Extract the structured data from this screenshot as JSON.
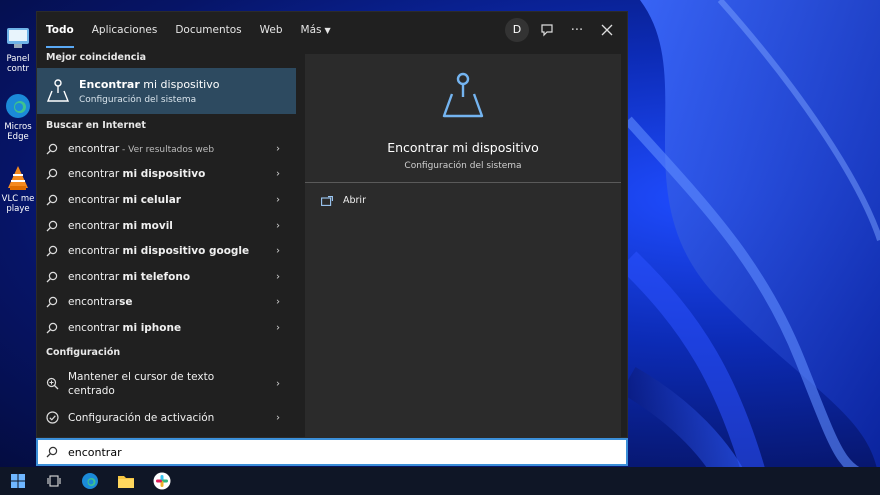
{
  "desktop": {
    "icons": [
      {
        "label": "Panel contr",
        "icon": "control-panel-icon"
      },
      {
        "label": "Micros Edge",
        "icon": "edge-icon"
      },
      {
        "label": "VLC me playe",
        "icon": "vlc-icon"
      }
    ]
  },
  "tabs": [
    {
      "label": "Todo",
      "active": true
    },
    {
      "label": "Aplicaciones"
    },
    {
      "label": "Documentos"
    },
    {
      "label": "Web"
    },
    {
      "label": "Más"
    }
  ],
  "top_actions": {
    "avatar": "D",
    "icons": [
      "feedback-icon",
      "more-icon",
      "close-icon"
    ]
  },
  "best_match": {
    "header": "Mejor coincidencia",
    "title_bold": "Encontrar",
    "title_rest": " mi dispositivo",
    "subtitle": "Configuración del sistema"
  },
  "internet": {
    "header": "Buscar en Internet",
    "items": [
      {
        "base": "encontrar",
        "bold": "",
        "suffix": " - Ver resultados web"
      },
      {
        "base": "encontrar ",
        "bold": "mi dispositivo",
        "suffix": ""
      },
      {
        "base": "encontrar ",
        "bold": "mi celular",
        "suffix": ""
      },
      {
        "base": "encontrar ",
        "bold": "mi movil",
        "suffix": ""
      },
      {
        "base": "encontrar ",
        "bold": "mi dispositivo google",
        "suffix": ""
      },
      {
        "base": "encontrar ",
        "bold": "mi telefono",
        "suffix": ""
      },
      {
        "base": "encontrar",
        "bold": "se",
        "suffix": ""
      },
      {
        "base": "encontrar ",
        "bold": "mi iphone",
        "suffix": ""
      }
    ]
  },
  "config": {
    "header": "Configuración",
    "items": [
      {
        "line1": "Mantener el cursor de texto",
        "line2": "centrado"
      },
      {
        "line1": "Configuración de activación",
        "line2": ""
      }
    ]
  },
  "preview": {
    "title": "Encontrar mi dispositivo",
    "subtitle": "Configuración del sistema",
    "action": "Abrir"
  },
  "search": {
    "value": "encontrar"
  },
  "taskbar": {
    "items": [
      "windows-start-icon",
      "task-view-icon",
      "edge-icon",
      "file-explorer-icon",
      "slack-icon"
    ]
  },
  "colors": {
    "accent": "#5aa9f5",
    "selected": "#2d4a60",
    "panel": "#202020",
    "preview": "#2b2b2b"
  }
}
